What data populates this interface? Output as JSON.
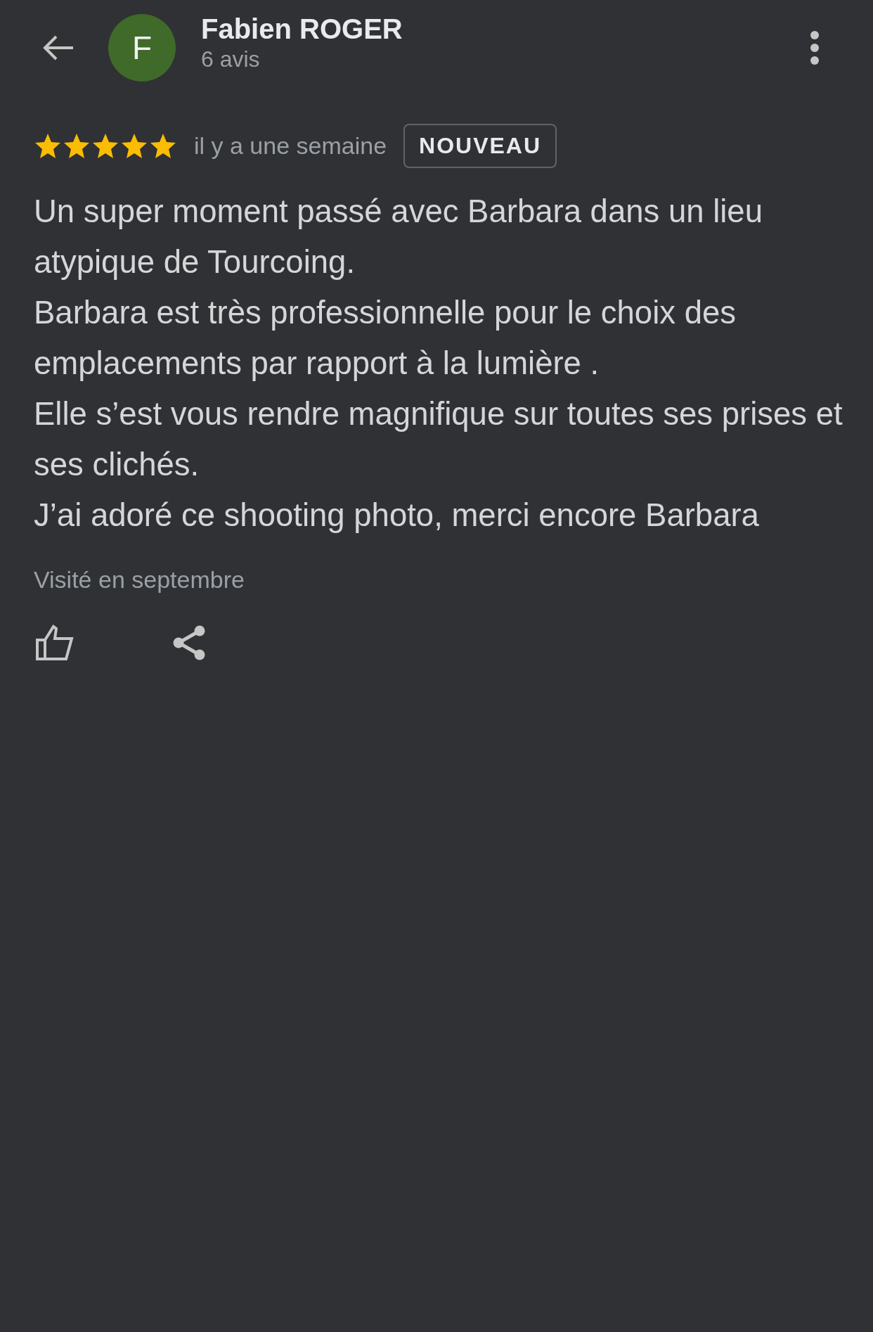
{
  "reviewer": {
    "initial": "F",
    "name": "Fabien ROGER",
    "review_count": "6 avis"
  },
  "review": {
    "stars": 5,
    "date": "il y a une semaine",
    "badge": "NOUVEAU",
    "paragraphs": [
      "Un super moment passé avec Barbara dans un lieu atypique de Tourcoing.",
      "Barbara est très professionnelle pour le choix des emplacements par rapport à la lumière .",
      "Elle s’est vous rendre magnifique sur toutes ses prises et ses clichés.",
      "J’ai adoré ce shooting photo, merci encore Barbara"
    ],
    "visited": "Visité en septembre"
  }
}
